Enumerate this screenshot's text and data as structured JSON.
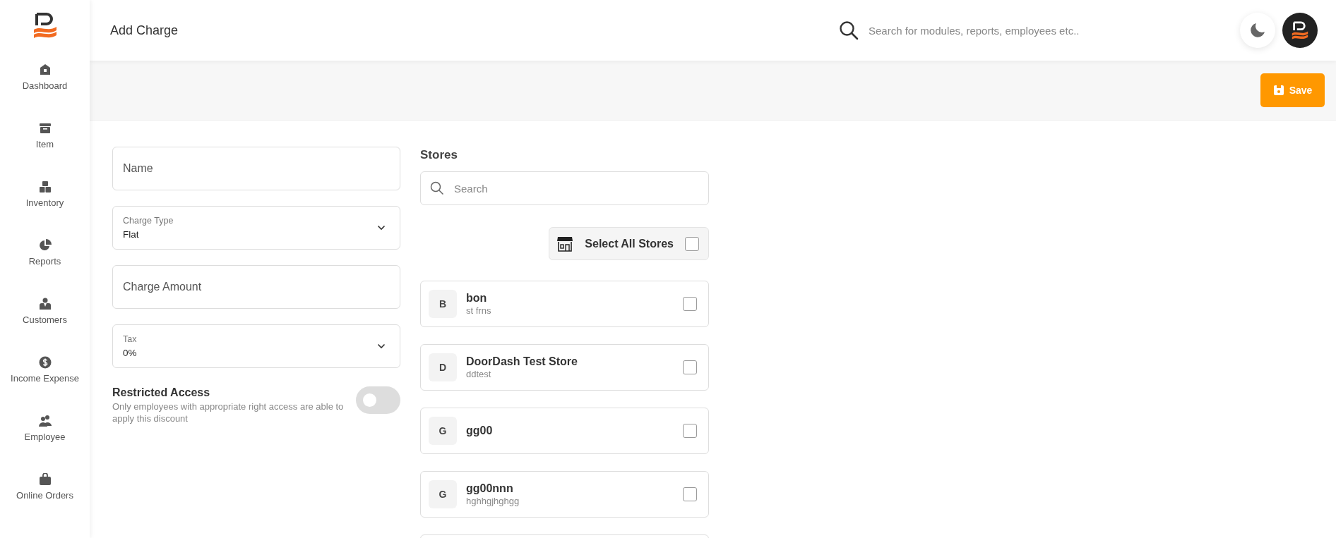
{
  "sidebar": {
    "items": [
      {
        "label": "Dashboard"
      },
      {
        "label": "Item"
      },
      {
        "label": "Inventory"
      },
      {
        "label": "Reports"
      },
      {
        "label": "Customers"
      },
      {
        "label": "Income Expense"
      },
      {
        "label": "Employee"
      },
      {
        "label": "Online Orders"
      }
    ]
  },
  "header": {
    "title": "Add Charge",
    "search": {
      "placeholder": "Search for modules, reports, employees etc.."
    }
  },
  "toolbar": {
    "save_button": "Save"
  },
  "form": {
    "fields": [
      {
        "kind": "input",
        "placeholder": "Name"
      },
      {
        "kind": "select",
        "label": "Charge Type",
        "value": "Flat"
      },
      {
        "kind": "input",
        "placeholder": "Charge Amount"
      },
      {
        "kind": "select",
        "label": "Tax",
        "value": "0%"
      }
    ],
    "restricted_access": {
      "title": "Restricted Access",
      "description": "Only employees with appropriate right access are able to apply this discount",
      "on": false
    }
  },
  "stores": {
    "heading": "Stores",
    "search": {
      "placeholder": "Search"
    },
    "select_all": {
      "label": "Select All Stores",
      "checked": false
    },
    "items": [
      {
        "initial": "B",
        "name": "bon",
        "code": "st frns",
        "checked": false
      },
      {
        "initial": "D",
        "name": "DoorDash Test Store",
        "code": "ddtest",
        "checked": false
      },
      {
        "initial": "G",
        "name": "gg00",
        "checked": false
      },
      {
        "initial": "G",
        "name": "gg00nnn",
        "code": "hghhgjhghgg",
        "checked": false
      }
    ]
  }
}
